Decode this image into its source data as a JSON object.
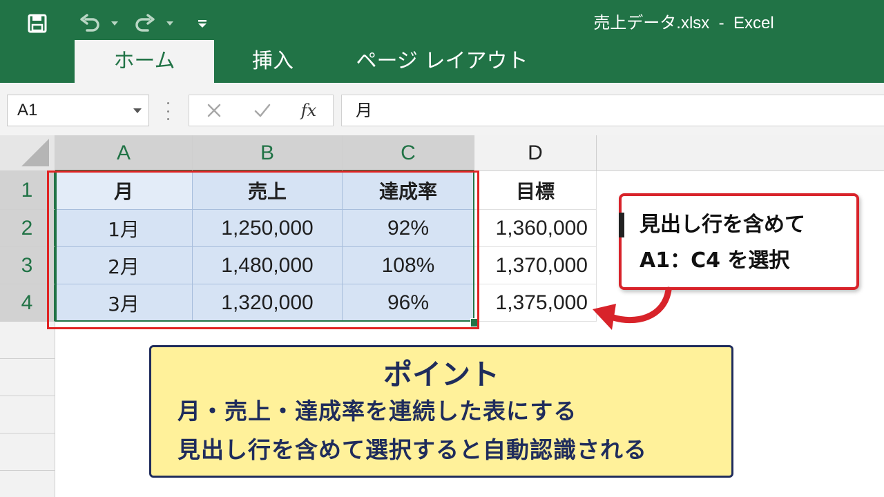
{
  "window": {
    "title": "売上データ.xlsx  -  Excel"
  },
  "quick_access": {
    "save_icon": "save-icon",
    "undo_icon": "undo-icon",
    "redo_icon": "redo-icon",
    "customize_icon": "customize-qat-icon"
  },
  "ribbon": {
    "tabs": [
      {
        "label": "ホーム",
        "active": true
      },
      {
        "label": "挿入",
        "active": false
      },
      {
        "label": "ページ レイアウト",
        "active": false
      }
    ]
  },
  "formula_bar": {
    "name_box": "A1",
    "fx_label": "fx",
    "content": "月"
  },
  "sheet": {
    "columns": [
      "A",
      "B",
      "C",
      "D"
    ],
    "rows": [
      "1",
      "2",
      "3",
      "4"
    ],
    "cells": [
      [
        "月",
        "売上",
        "達成率",
        "目標"
      ],
      [
        "1月",
        "1,250,000",
        "92%",
        "1,360,000"
      ],
      [
        "2月",
        "1,480,000",
        "108%",
        "1,370,000"
      ],
      [
        "3月",
        "1,320,000",
        "96%",
        "1,375,000"
      ]
    ],
    "selection": "A1:C4"
  },
  "annotations": {
    "select_callout": {
      "line1": "見出し行を含めて",
      "line2": "A1：C4 を選択"
    },
    "point_box": {
      "title": "ポイント",
      "line1": "月・売上・達成率を連続した表にする",
      "line2": "見出し行を含めて選択すると自動認識される"
    }
  },
  "colors": {
    "excel_green": "#217346",
    "selection_fill": "#d6e3f4",
    "highlight_red": "#e02424",
    "point_fill": "#fff19a",
    "point_border": "#1f2c5c"
  }
}
